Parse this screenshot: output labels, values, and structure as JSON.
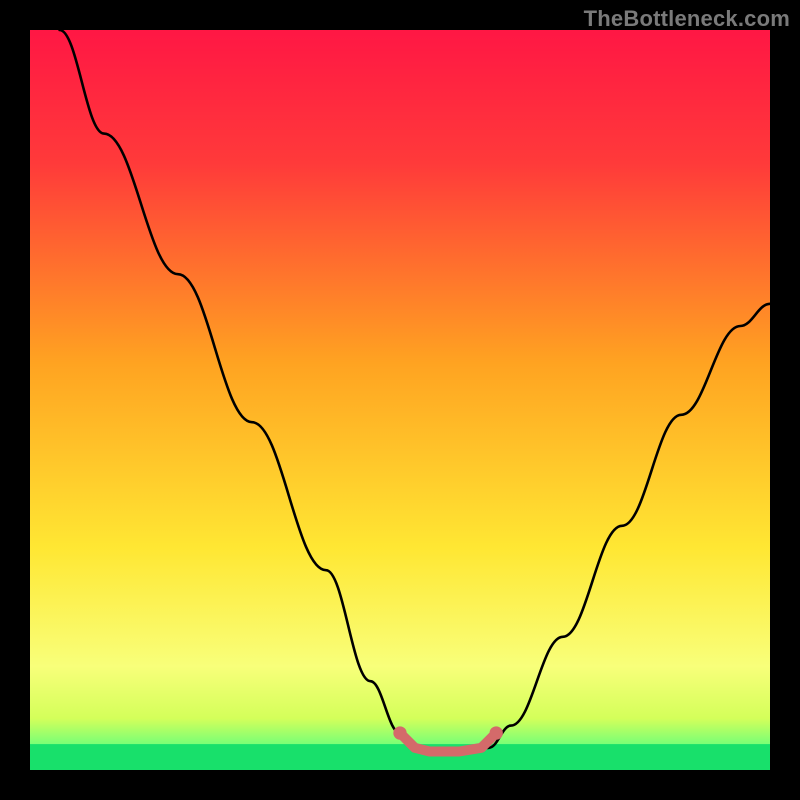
{
  "watermark": {
    "text": "TheBottleneck.com"
  },
  "chart_data": {
    "type": "line",
    "title": "",
    "xlabel": "",
    "ylabel": "",
    "xlim": [
      0,
      100
    ],
    "ylim": [
      0,
      100
    ],
    "grid": false,
    "gradient_stops": [
      {
        "offset": 0.0,
        "color": "#ff1744"
      },
      {
        "offset": 0.18,
        "color": "#ff3a3a"
      },
      {
        "offset": 0.45,
        "color": "#ffa321"
      },
      {
        "offset": 0.7,
        "color": "#ffe733"
      },
      {
        "offset": 0.86,
        "color": "#f8ff7a"
      },
      {
        "offset": 0.93,
        "color": "#d4ff5a"
      },
      {
        "offset": 0.97,
        "color": "#6cff7a"
      },
      {
        "offset": 1.0,
        "color": "#18e06b"
      }
    ],
    "green_band": {
      "y_start": 96.5,
      "y_end": 100
    },
    "series": [
      {
        "name": "left-arm",
        "x": [
          4,
          10,
          20,
          30,
          40,
          46,
          50,
          52
        ],
        "y": [
          100,
          86,
          67,
          47,
          27,
          12,
          5,
          3
        ]
      },
      {
        "name": "valley-pad",
        "x": [
          52,
          54,
          56,
          58,
          60,
          62
        ],
        "y": [
          3,
          2.5,
          2.5,
          2.5,
          2.5,
          3
        ]
      },
      {
        "name": "right-arm",
        "x": [
          62,
          65,
          72,
          80,
          88,
          96,
          100
        ],
        "y": [
          3,
          6,
          18,
          33,
          48,
          60,
          63
        ]
      }
    ],
    "valley_marker": {
      "color": "#d46a6a",
      "thickness": 10,
      "x": [
        50,
        52,
        54,
        58,
        61,
        63
      ],
      "y": [
        5,
        3,
        2.5,
        2.5,
        3,
        5
      ]
    }
  }
}
